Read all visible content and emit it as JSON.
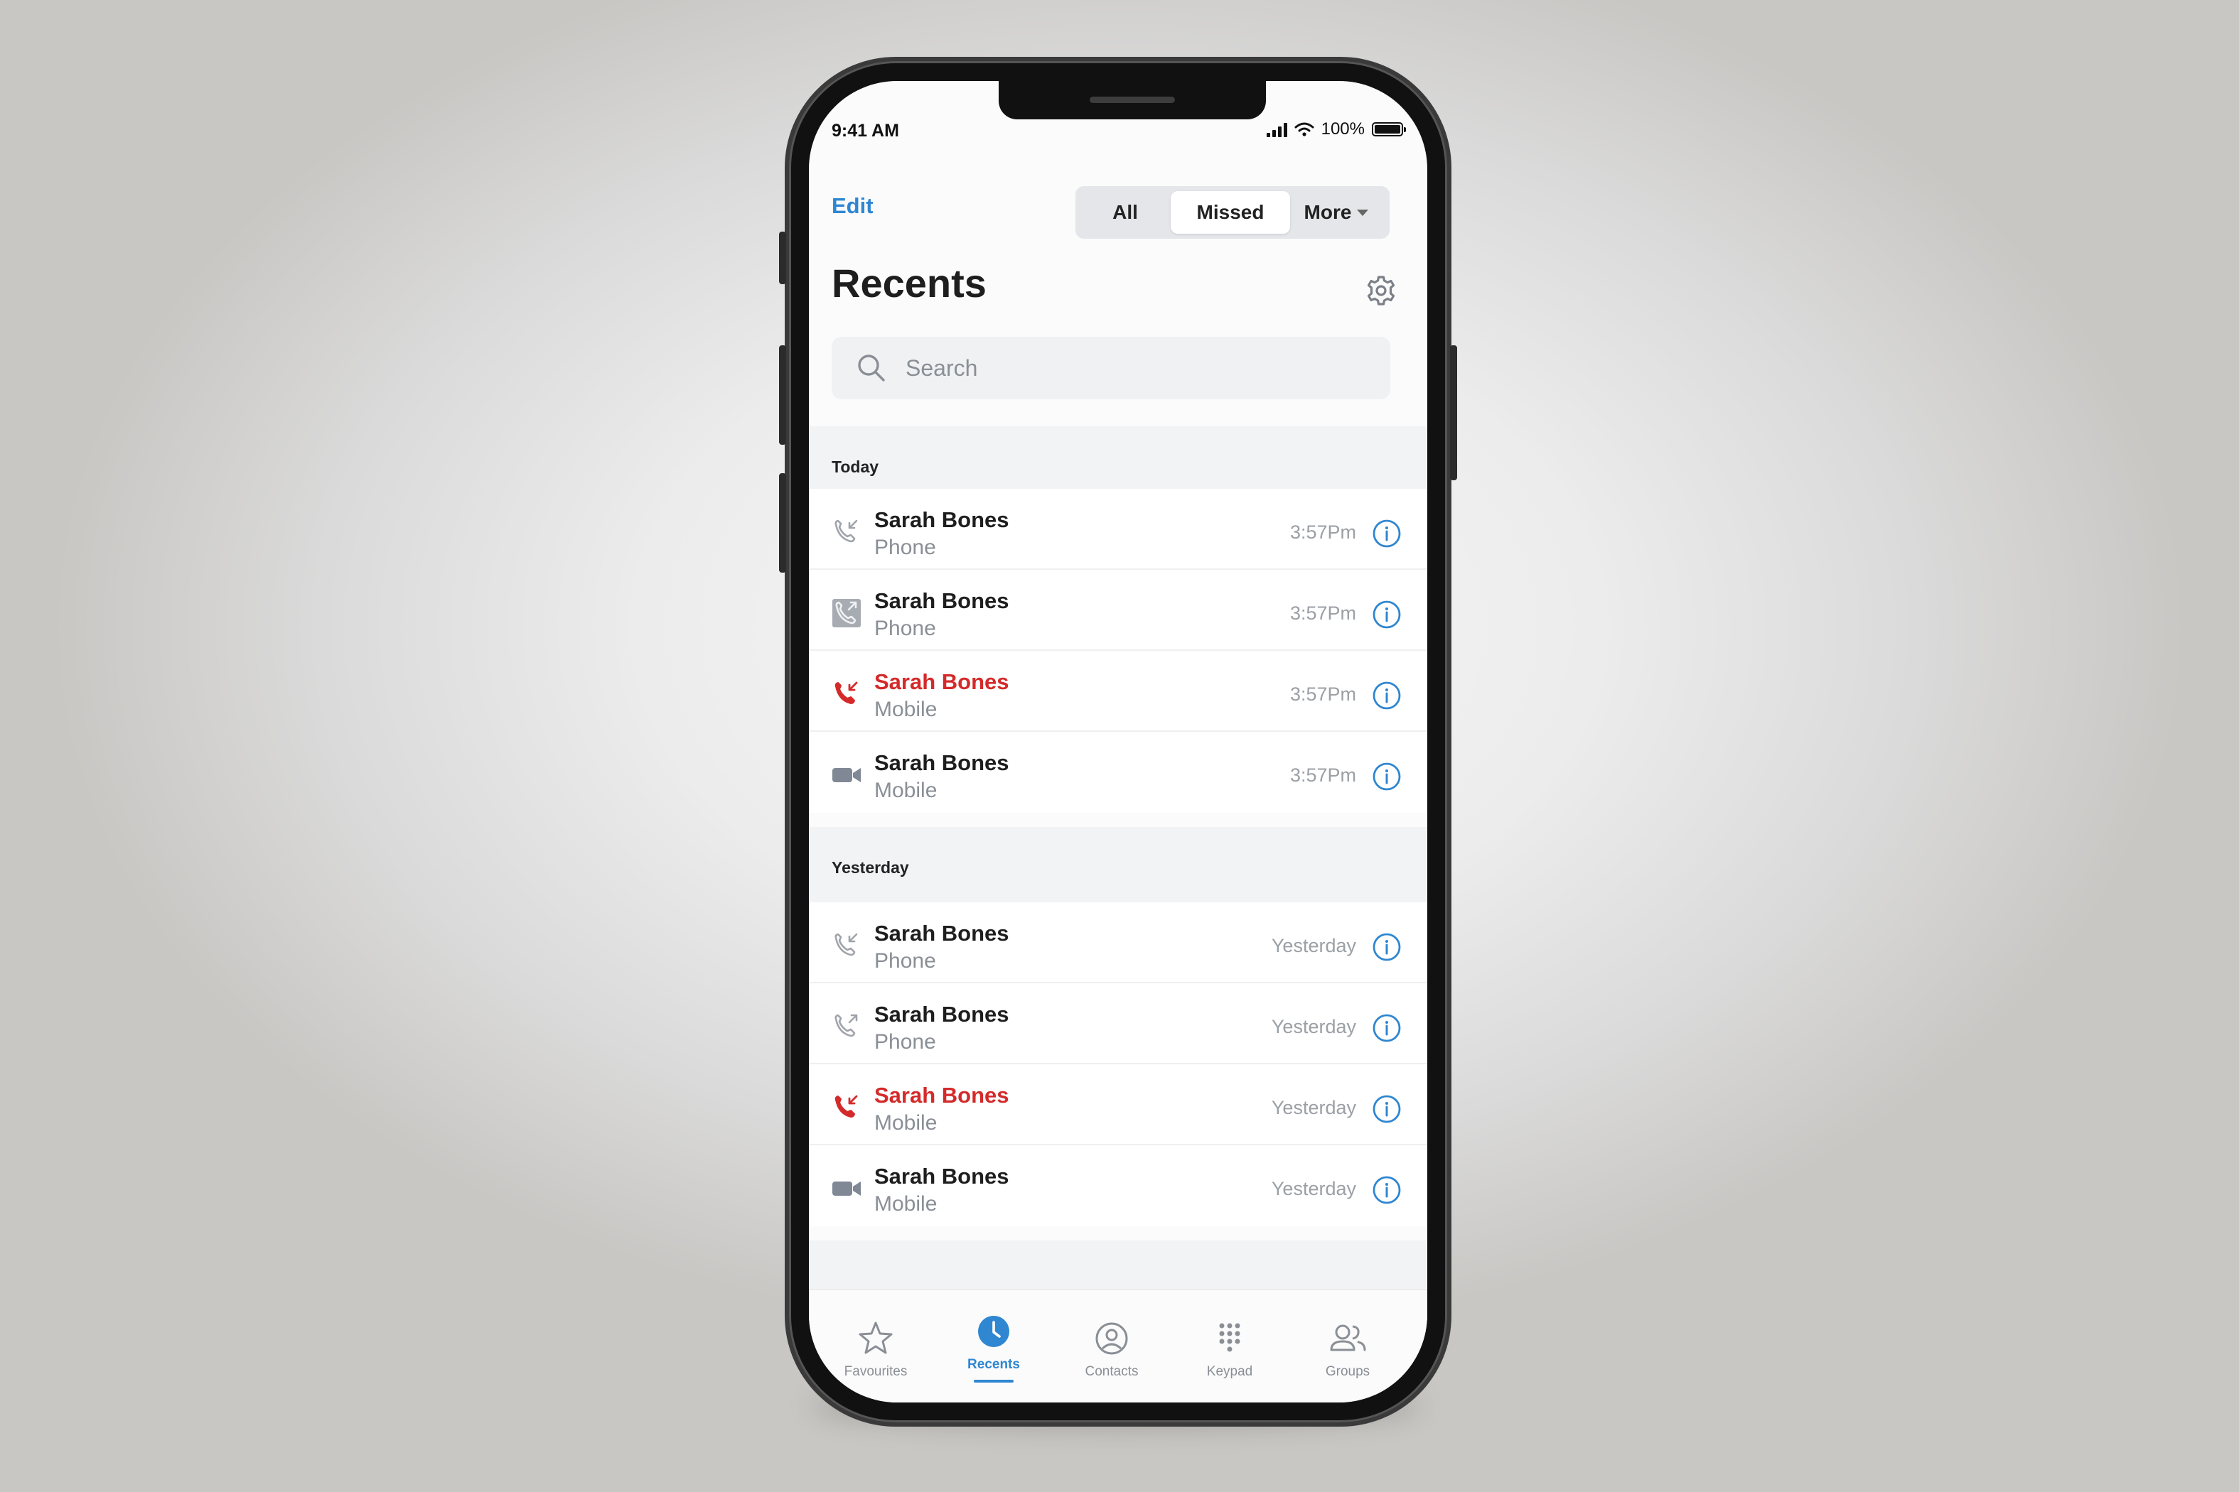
{
  "status_bar": {
    "time": "9:41 AM",
    "battery": "100%"
  },
  "header": {
    "edit_label": "Edit",
    "segments": {
      "all": "All",
      "missed": "Missed",
      "more": "More"
    },
    "title": "Recents"
  },
  "search": {
    "placeholder": "Search"
  },
  "sections": [
    {
      "label": "Today",
      "rows": [
        {
          "name": "Sarah Bones",
          "type": "Phone",
          "time": "3:57Pm",
          "kind": "incoming"
        },
        {
          "name": "Sarah Bones",
          "type": "Phone",
          "time": "3:57Pm",
          "kind": "outgoing"
        },
        {
          "name": "Sarah Bones",
          "type": "Mobile",
          "time": "3:57Pm",
          "kind": "missed"
        },
        {
          "name": "Sarah Bones",
          "type": "Mobile",
          "time": "3:57Pm",
          "kind": "video"
        }
      ]
    },
    {
      "label": "Yesterday",
      "rows": [
        {
          "name": "Sarah Bones",
          "type": "Phone",
          "time": "Yesterday",
          "kind": "incoming"
        },
        {
          "name": "Sarah Bones",
          "type": "Phone",
          "time": "Yesterday",
          "kind": "outgoing"
        },
        {
          "name": "Sarah Bones",
          "type": "Mobile",
          "time": "Yesterday",
          "kind": "missed"
        },
        {
          "name": "Sarah Bones",
          "type": "Mobile",
          "time": "Yesterday",
          "kind": "video"
        }
      ]
    }
  ],
  "tabbar": {
    "favourites": "Favourites",
    "recents": "Recents",
    "contacts": "Contacts",
    "keypad": "Keypad",
    "groups": "Groups"
  },
  "colors": {
    "accent": "#2f86d1",
    "missed": "#d42a2a",
    "muted": "#8a8f96"
  }
}
